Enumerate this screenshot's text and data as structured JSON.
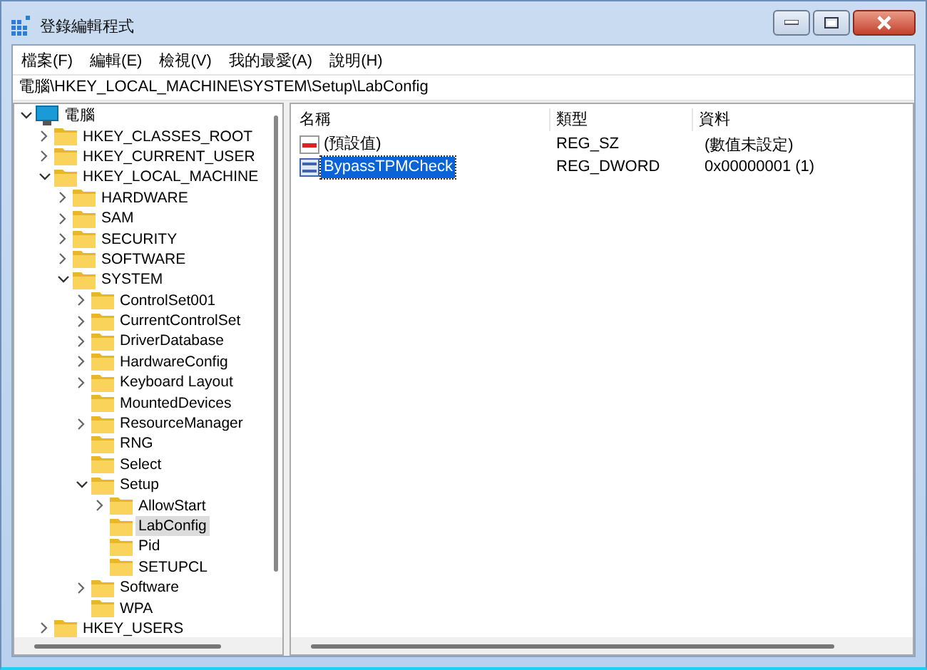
{
  "window": {
    "title": "登錄編輯程式"
  },
  "menu": [
    "檔案(F)",
    "編輯(E)",
    "檢視(V)",
    "我的最愛(A)",
    "說明(H)"
  ],
  "address": "電腦\\HKEY_LOCAL_MACHINE\\SYSTEM\\Setup\\LabConfig",
  "tree": {
    "label": "電腦",
    "kind": "expanded",
    "selected": false,
    "children": [
      {
        "label": "HKEY_CLASSES_ROOT",
        "kind": "collapsed",
        "selected": false
      },
      {
        "label": "HKEY_CURRENT_USER",
        "kind": "collapsed",
        "selected": false
      },
      {
        "label": "HKEY_LOCAL_MACHINE",
        "kind": "expanded",
        "selected": false,
        "children": [
          {
            "label": "HARDWARE",
            "kind": "collapsed",
            "selected": false
          },
          {
            "label": "SAM",
            "kind": "collapsed",
            "selected": false
          },
          {
            "label": "SECURITY",
            "kind": "collapsed",
            "selected": false
          },
          {
            "label": "SOFTWARE",
            "kind": "collapsed",
            "selected": false
          },
          {
            "label": "SYSTEM",
            "kind": "expanded",
            "selected": false,
            "children": [
              {
                "label": "ControlSet001",
                "kind": "collapsed",
                "selected": false
              },
              {
                "label": "CurrentControlSet",
                "kind": "collapsed",
                "selected": false
              },
              {
                "label": "DriverDatabase",
                "kind": "collapsed",
                "selected": false
              },
              {
                "label": "HardwareConfig",
                "kind": "collapsed",
                "selected": false
              },
              {
                "label": "Keyboard Layout",
                "kind": "collapsed",
                "selected": false
              },
              {
                "label": "MountedDevices",
                "kind": "leaf",
                "selected": false
              },
              {
                "label": "ResourceManager",
                "kind": "collapsed",
                "selected": false
              },
              {
                "label": "RNG",
                "kind": "leaf",
                "selected": false
              },
              {
                "label": "Select",
                "kind": "leaf",
                "selected": false
              },
              {
                "label": "Setup",
                "kind": "expanded",
                "selected": false,
                "children": [
                  {
                    "label": "AllowStart",
                    "kind": "collapsed",
                    "selected": false
                  },
                  {
                    "label": "LabConfig",
                    "kind": "leaf",
                    "selected": true
                  },
                  {
                    "label": "Pid",
                    "kind": "leaf",
                    "selected": false
                  },
                  {
                    "label": "SETUPCL",
                    "kind": "leaf",
                    "selected": false
                  }
                ]
              },
              {
                "label": "Software",
                "kind": "collapsed",
                "selected": false
              },
              {
                "label": "WPA",
                "kind": "leaf",
                "selected": false
              }
            ]
          }
        ]
      },
      {
        "label": "HKEY_USERS",
        "kind": "collapsed",
        "selected": false
      }
    ]
  },
  "table": {
    "columns": [
      "名稱",
      "類型",
      "資料"
    ],
    "rows": [
      {
        "kind": "string",
        "name": "(預設值)",
        "type": "REG_SZ",
        "data": "(數值未設定)",
        "selected": false
      },
      {
        "kind": "binary",
        "name": "BypassTPMCheck",
        "type": "REG_DWORD",
        "data": "0x00000001 (1)",
        "selected": true
      }
    ]
  }
}
